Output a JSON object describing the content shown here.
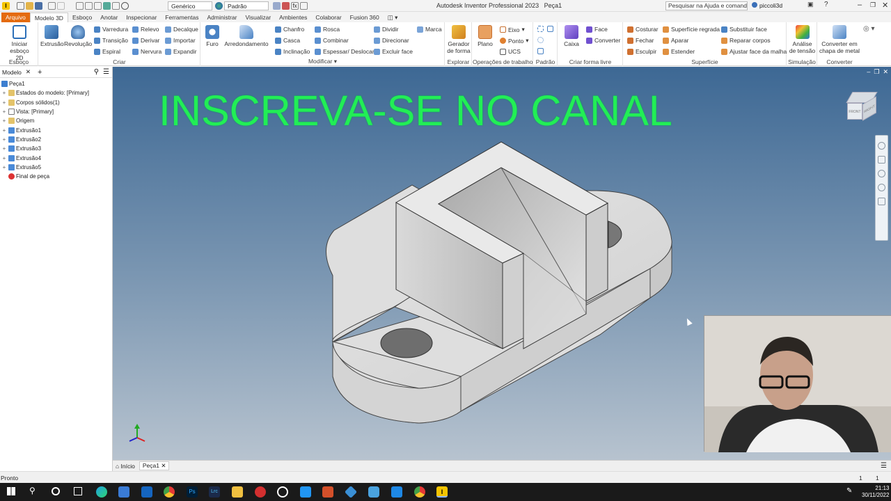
{
  "app": {
    "title": "Autodesk Inventor Professional 2023",
    "doc": "Peça1",
    "appearance": "Genérico",
    "style": "Padrão",
    "search_placeholder": "Pesquisar na Ajuda e comandos...",
    "user": "piccoli3d"
  },
  "tabs": [
    "Arquivo",
    "Modelo 3D",
    "Esboço",
    "Anotar",
    "Inspecionar",
    "Ferramentas",
    "Administrar",
    "Visualizar",
    "Ambientes",
    "Colaborar",
    "Fusion 360"
  ],
  "ribbon": {
    "esboco": {
      "label": "Esboço",
      "btn": "Iniciar esboço 2D"
    },
    "criar": {
      "label": "Criar",
      "big": [
        "Extrusão",
        "Revolução"
      ],
      "col1": [
        "Varredura",
        "Transição",
        "Espiral"
      ],
      "col2": [
        "Relevo",
        "Derivar",
        "Nervura"
      ],
      "col3": [
        "Decalque",
        "Importar",
        "Expandir"
      ]
    },
    "modificar": {
      "label": "Modificar",
      "big": [
        "Furo",
        "Arredondamento"
      ],
      "col1": [
        "Chanfro",
        "Casca",
        "Inclinação"
      ],
      "col2": [
        "Rosca",
        "Combinar",
        "Espessar/ Deslocar"
      ],
      "col3": [
        "Dividir",
        "Direcionar",
        "Excluir face"
      ],
      "col4": [
        "Marca"
      ]
    },
    "explorar": {
      "label": "Explorar",
      "btn": "Gerador de forma"
    },
    "trabalho": {
      "label": "Operações de trabalho",
      "btn": "Plano",
      "items": [
        "Eixo",
        "Ponto",
        "UCS"
      ]
    },
    "padrao": {
      "label": "Padrão"
    },
    "formalivre": {
      "label": "Criar forma livre",
      "btn": "Caixa",
      "items": [
        "Face",
        "Converter"
      ]
    },
    "superficie": {
      "label": "Superfície",
      "col1": [
        "Costurar",
        "Fechar",
        "Esculpir"
      ],
      "col2": [
        "Superfície regrada",
        "Aparar",
        "Estender"
      ],
      "col3": [
        "Substituir face",
        "Reparar corpos",
        "Ajustar face da malha"
      ]
    },
    "simulacao": {
      "label": "Simulação",
      "btn": "Análise de tensão"
    },
    "converter": {
      "label": "Converter",
      "btn": "Converter em chapa de metal"
    }
  },
  "browser": {
    "tab": "Modelo",
    "nodes": [
      "Peça1",
      "Estados do modelo: [Primary]",
      "Corpos sólidos(1)",
      "Vista: [Primary]",
      "Origem",
      "Extrusão1",
      "Extrusão2",
      "Extrusão3",
      "Extrusão4",
      "Extrusão5",
      "Final de peça"
    ]
  },
  "viewport": {
    "banner": "INSCREVA-SE NO CANAL",
    "viewcube_labels": [
      "FRONT",
      "RIGHT"
    ],
    "axes": [
      "x",
      "y",
      "z"
    ]
  },
  "doctabs": [
    "Início",
    "Peça1"
  ],
  "status": {
    "left": "Pronto",
    "n1": "1",
    "n2": "1"
  },
  "taskbar": {
    "time": "21:13",
    "date": "30/11/2022"
  }
}
